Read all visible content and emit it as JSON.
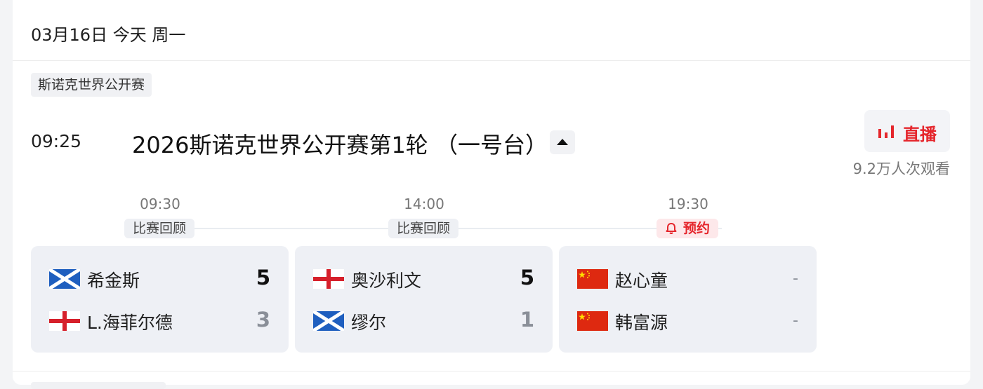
{
  "date_header": "03月16日 今天 周一",
  "tournament_tag": "斯诺克世界公开赛",
  "event": {
    "time": "09:25",
    "title": "2026斯诺克世界公开赛第1轮 （一号台）",
    "live_label": "直播",
    "viewers": "9.2万人次观看"
  },
  "stages": [
    {
      "time": "09:30",
      "label": "比赛回顾"
    },
    {
      "time": "14:00",
      "label": "比赛回顾"
    },
    {
      "time": "19:30",
      "label": "预约"
    }
  ],
  "matches": [
    {
      "players": [
        {
          "flag": "scotland-flag",
          "name": "希金斯",
          "score": "5"
        },
        {
          "flag": "england-flag",
          "name": "L.海菲尔德",
          "score": "3"
        }
      ]
    },
    {
      "players": [
        {
          "flag": "england-flag",
          "name": "奥沙利文",
          "score": "5"
        },
        {
          "flag": "scotland-flag",
          "name": "缪尔",
          "score": "1"
        }
      ]
    },
    {
      "players": [
        {
          "flag": "china-flag",
          "name": "赵心童",
          "score": "-"
        },
        {
          "flag": "china-flag",
          "name": "韩富源",
          "score": "-"
        }
      ]
    }
  ],
  "colors": {
    "accent_red": "#e5262c",
    "card_bg": "#eef0f5"
  }
}
